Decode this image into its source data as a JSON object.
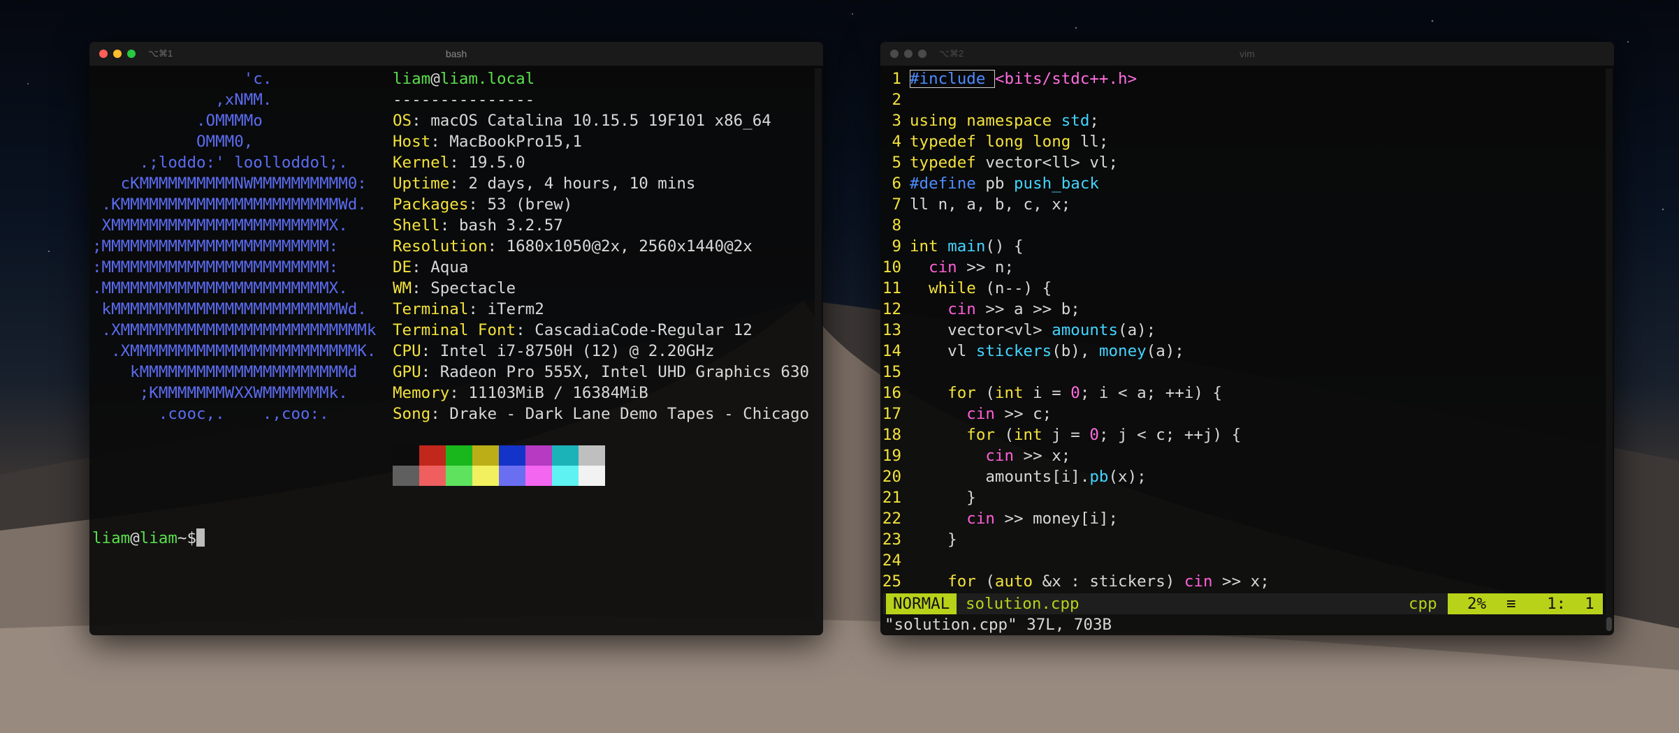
{
  "desktop": {
    "theme": "macOS Catalina dark dunes"
  },
  "left_window": {
    "shortcut": "⌥⌘1",
    "title": "bash",
    "ascii_art": [
      "                'c.",
      "             ,xNMM.",
      "           .OMMMMo",
      "           OMMM0,",
      "     .;loddo:' loolloddol;.",
      "   cKMMMMMMMMMMNWMMMMMMMMMM0:",
      " .KMMMMMMMMMMMMMMMMMMMMMMMWd.",
      " XMMMMMMMMMMMMMMMMMMMMMMMX.",
      ";MMMMMMMMMMMMMMMMMMMMMMMM:",
      ":MMMMMMMMMMMMMMMMMMMMMMMM:",
      ".MMMMMMMMMMMMMMMMMMMMMMMMX.",
      " kMMMMMMMMMMMMMMMMMMMMMMMMWd.",
      " .XMMMMMMMMMMMMMMMMMMMMMMMMMMk",
      "  .XMMMMMMMMMMMMMMMMMMMMMMMMK.",
      "    kMMMMMMMMMMMMMMMMMMMMMMd",
      "     ;KMMMMMMMWXXWMMMMMMMk.",
      "       .cooc,.    .,coo:."
    ],
    "user": "liam",
    "at": "@",
    "host": "liam.local",
    "separator": "---------------",
    "info": [
      {
        "key": "OS",
        "value": "macOS Catalina 10.15.5 19F101 x86_64"
      },
      {
        "key": "Host",
        "value": "MacBookPro15,1"
      },
      {
        "key": "Kernel",
        "value": "19.5.0"
      },
      {
        "key": "Uptime",
        "value": "2 days, 4 hours, 10 mins"
      },
      {
        "key": "Packages",
        "value": "53 (brew)"
      },
      {
        "key": "Shell",
        "value": "bash 3.2.57"
      },
      {
        "key": "Resolution",
        "value": "1680x1050@2x, 2560x1440@2x"
      },
      {
        "key": "DE",
        "value": "Aqua"
      },
      {
        "key": "WM",
        "value": "Spectacle"
      },
      {
        "key": "Terminal",
        "value": "iTerm2"
      },
      {
        "key": "Terminal Font",
        "value": "CascadiaCode-Regular 12"
      },
      {
        "key": "CPU",
        "value": "Intel i7-8750H (12) @ 2.20GHz"
      },
      {
        "key": "GPU",
        "value": "Radeon Pro 555X, Intel UHD Graphics 630"
      },
      {
        "key": "Memory",
        "value": "11103MiB / 16384MiB"
      },
      {
        "key": "Song",
        "value": "Drake - Dark Lane Demo Tapes - Chicago"
      }
    ],
    "palette_top": [
      "#0c0c0c",
      "#c1271a",
      "#1ab71c",
      "#bcae17",
      "#1433c8",
      "#b63ac2",
      "#1bb3b8",
      "#bfbfbf"
    ],
    "palette_bottom": [
      "#5f5f5f",
      "#ef5f5f",
      "#5fe35f",
      "#f2f05e",
      "#6a6ff2",
      "#f366ef",
      "#5ff2f2",
      "#f2f2f2"
    ],
    "prompt": {
      "user": "liam",
      "at": "@",
      "host": "liam",
      "path": "~",
      "symbol": "$"
    }
  },
  "right_window": {
    "shortcut": "⌥⌘2",
    "title": "vim",
    "code": [
      [
        [
          "c-pre",
          "#include "
        ],
        [
          "c-str",
          "<bits/stdc++.h>"
        ]
      ],
      [],
      [
        [
          "c-kw",
          "using namespace "
        ],
        [
          "c-fn",
          "std"
        ],
        [
          "c-tx",
          ";"
        ]
      ],
      [
        [
          "c-kw",
          "typedef long long "
        ],
        [
          "c-tx",
          "ll;"
        ]
      ],
      [
        [
          "c-kw",
          "typedef "
        ],
        [
          "c-tx",
          "vector<ll> vl;"
        ]
      ],
      [
        [
          "c-pre",
          "#define "
        ],
        [
          "c-tx",
          "pb "
        ],
        [
          "c-fn",
          "push_back"
        ]
      ],
      [
        [
          "c-tx",
          "ll n, a, b, c, x;"
        ]
      ],
      [],
      [
        [
          "c-kw",
          "int "
        ],
        [
          "c-fn",
          "main"
        ],
        [
          "c-tx",
          "() {"
        ]
      ],
      [
        [
          "c-tx",
          "  "
        ],
        [
          "c-mag",
          "cin"
        ],
        [
          "c-tx",
          " >> n;"
        ]
      ],
      [
        [
          "c-tx",
          "  "
        ],
        [
          "c-kw",
          "while"
        ],
        [
          "c-tx",
          " (n--) {"
        ]
      ],
      [
        [
          "c-tx",
          "    "
        ],
        [
          "c-mag",
          "cin"
        ],
        [
          "c-tx",
          " >> a >> b;"
        ]
      ],
      [
        [
          "c-tx",
          "    vector<vl> "
        ],
        [
          "c-fn",
          "amounts"
        ],
        [
          "c-tx",
          "(a);"
        ]
      ],
      [
        [
          "c-tx",
          "    vl "
        ],
        [
          "c-fn",
          "stickers"
        ],
        [
          "c-tx",
          "(b), "
        ],
        [
          "c-fn",
          "money"
        ],
        [
          "c-tx",
          "(a);"
        ]
      ],
      [],
      [
        [
          "c-tx",
          "    "
        ],
        [
          "c-kw",
          "for"
        ],
        [
          "c-tx",
          " ("
        ],
        [
          "c-kw",
          "int"
        ],
        [
          "c-tx",
          " i = "
        ],
        [
          "c-num",
          "0"
        ],
        [
          "c-tx",
          "; i < a; ++i) {"
        ]
      ],
      [
        [
          "c-tx",
          "      "
        ],
        [
          "c-mag",
          "cin"
        ],
        [
          "c-tx",
          " >> c;"
        ]
      ],
      [
        [
          "c-tx",
          "      "
        ],
        [
          "c-kw",
          "for"
        ],
        [
          "c-tx",
          " ("
        ],
        [
          "c-kw",
          "int"
        ],
        [
          "c-tx",
          " j = "
        ],
        [
          "c-num",
          "0"
        ],
        [
          "c-tx",
          "; j < c; ++j) {"
        ]
      ],
      [
        [
          "c-tx",
          "        "
        ],
        [
          "c-mag",
          "cin"
        ],
        [
          "c-tx",
          " >> x;"
        ]
      ],
      [
        [
          "c-tx",
          "        amounts[i]."
        ],
        [
          "c-fn",
          "pb"
        ],
        [
          "c-tx",
          "(x);"
        ]
      ],
      [
        [
          "c-tx",
          "      }"
        ]
      ],
      [
        [
          "c-tx",
          "      "
        ],
        [
          "c-mag",
          "cin"
        ],
        [
          "c-tx",
          " >> money[i];"
        ]
      ],
      [
        [
          "c-tx",
          "    }"
        ]
      ],
      [],
      [
        [
          "c-tx",
          "    "
        ],
        [
          "c-kw",
          "for"
        ],
        [
          "c-tx",
          " ("
        ],
        [
          "c-kw",
          "auto"
        ],
        [
          "c-tx",
          " &x : stickers) "
        ],
        [
          "c-mag",
          "cin"
        ],
        [
          "c-tx",
          " >> x;"
        ]
      ]
    ],
    "status": {
      "mode": "NORMAL",
      "filename": "solution.cpp",
      "filetype": "cpp",
      "percent": "2%",
      "lines_icon": "≡",
      "position": "1:  1"
    },
    "command_line": "\"solution.cpp\" 37L, 703B"
  }
}
